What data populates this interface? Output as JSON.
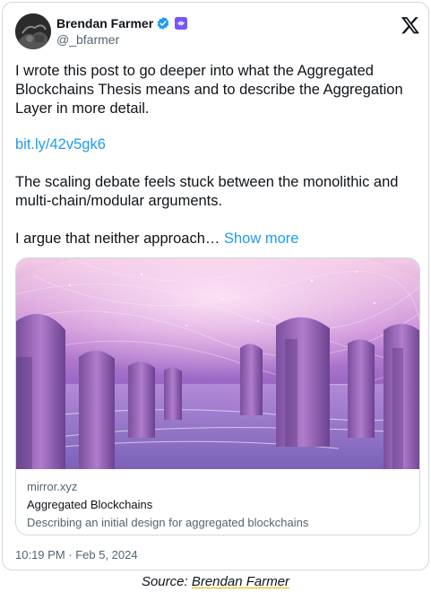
{
  "author": {
    "display_name": "Brendan Farmer",
    "handle": "@_bfarmer",
    "verified_icon": "verified-badge-icon",
    "affiliate_icon": "affiliate-badge-icon"
  },
  "tweet": {
    "paragraph_1": "I wrote this post to go deeper into what the Aggregated Blockchains Thesis means and to describe the Aggregation Layer in more detail.",
    "link": "bit.ly/42v5gk6",
    "paragraph_2": "The scaling debate feels stuck between the monolithic and multi-chain/modular arguments.",
    "paragraph_3": "I argue that neither approach…",
    "show_more": "Show more",
    "timestamp": "10:19 PM · Feb 5, 2024"
  },
  "link_card": {
    "domain": "mirror.xyz",
    "title": "Aggregated Blockchains",
    "description": "Describing an initial design for aggregated blockchains"
  },
  "caption": {
    "prefix": "Source: ",
    "link_text": "Brendan Farmer"
  },
  "colors": {
    "accent": "#1d9bf0",
    "verified": "#1d9bf0",
    "affiliate": "#7856ff",
    "secondary_text": "#536471"
  }
}
